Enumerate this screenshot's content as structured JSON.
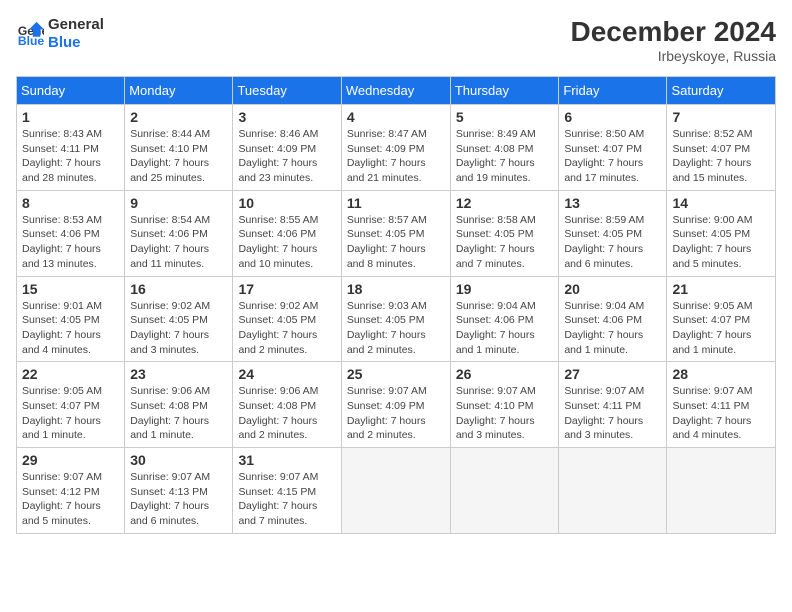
{
  "logo": {
    "line1": "General",
    "line2": "Blue"
  },
  "title": "December 2024",
  "location": "Irbeyskoye, Russia",
  "days_header": [
    "Sunday",
    "Monday",
    "Tuesday",
    "Wednesday",
    "Thursday",
    "Friday",
    "Saturday"
  ],
  "weeks": [
    [
      {
        "day": "1",
        "info": "Sunrise: 8:43 AM\nSunset: 4:11 PM\nDaylight: 7 hours\nand 28 minutes."
      },
      {
        "day": "2",
        "info": "Sunrise: 8:44 AM\nSunset: 4:10 PM\nDaylight: 7 hours\nand 25 minutes."
      },
      {
        "day": "3",
        "info": "Sunrise: 8:46 AM\nSunset: 4:09 PM\nDaylight: 7 hours\nand 23 minutes."
      },
      {
        "day": "4",
        "info": "Sunrise: 8:47 AM\nSunset: 4:09 PM\nDaylight: 7 hours\nand 21 minutes."
      },
      {
        "day": "5",
        "info": "Sunrise: 8:49 AM\nSunset: 4:08 PM\nDaylight: 7 hours\nand 19 minutes."
      },
      {
        "day": "6",
        "info": "Sunrise: 8:50 AM\nSunset: 4:07 PM\nDaylight: 7 hours\nand 17 minutes."
      },
      {
        "day": "7",
        "info": "Sunrise: 8:52 AM\nSunset: 4:07 PM\nDaylight: 7 hours\nand 15 minutes."
      }
    ],
    [
      {
        "day": "8",
        "info": "Sunrise: 8:53 AM\nSunset: 4:06 PM\nDaylight: 7 hours\nand 13 minutes."
      },
      {
        "day": "9",
        "info": "Sunrise: 8:54 AM\nSunset: 4:06 PM\nDaylight: 7 hours\nand 11 minutes."
      },
      {
        "day": "10",
        "info": "Sunrise: 8:55 AM\nSunset: 4:06 PM\nDaylight: 7 hours\nand 10 minutes."
      },
      {
        "day": "11",
        "info": "Sunrise: 8:57 AM\nSunset: 4:05 PM\nDaylight: 7 hours\nand 8 minutes."
      },
      {
        "day": "12",
        "info": "Sunrise: 8:58 AM\nSunset: 4:05 PM\nDaylight: 7 hours\nand 7 minutes."
      },
      {
        "day": "13",
        "info": "Sunrise: 8:59 AM\nSunset: 4:05 PM\nDaylight: 7 hours\nand 6 minutes."
      },
      {
        "day": "14",
        "info": "Sunrise: 9:00 AM\nSunset: 4:05 PM\nDaylight: 7 hours\nand 5 minutes."
      }
    ],
    [
      {
        "day": "15",
        "info": "Sunrise: 9:01 AM\nSunset: 4:05 PM\nDaylight: 7 hours\nand 4 minutes."
      },
      {
        "day": "16",
        "info": "Sunrise: 9:02 AM\nSunset: 4:05 PM\nDaylight: 7 hours\nand 3 minutes."
      },
      {
        "day": "17",
        "info": "Sunrise: 9:02 AM\nSunset: 4:05 PM\nDaylight: 7 hours\nand 2 minutes."
      },
      {
        "day": "18",
        "info": "Sunrise: 9:03 AM\nSunset: 4:05 PM\nDaylight: 7 hours\nand 2 minutes."
      },
      {
        "day": "19",
        "info": "Sunrise: 9:04 AM\nSunset: 4:06 PM\nDaylight: 7 hours\nand 1 minute."
      },
      {
        "day": "20",
        "info": "Sunrise: 9:04 AM\nSunset: 4:06 PM\nDaylight: 7 hours\nand 1 minute."
      },
      {
        "day": "21",
        "info": "Sunrise: 9:05 AM\nSunset: 4:07 PM\nDaylight: 7 hours\nand 1 minute."
      }
    ],
    [
      {
        "day": "22",
        "info": "Sunrise: 9:05 AM\nSunset: 4:07 PM\nDaylight: 7 hours\nand 1 minute."
      },
      {
        "day": "23",
        "info": "Sunrise: 9:06 AM\nSunset: 4:08 PM\nDaylight: 7 hours\nand 1 minute."
      },
      {
        "day": "24",
        "info": "Sunrise: 9:06 AM\nSunset: 4:08 PM\nDaylight: 7 hours\nand 2 minutes."
      },
      {
        "day": "25",
        "info": "Sunrise: 9:07 AM\nSunset: 4:09 PM\nDaylight: 7 hours\nand 2 minutes."
      },
      {
        "day": "26",
        "info": "Sunrise: 9:07 AM\nSunset: 4:10 PM\nDaylight: 7 hours\nand 3 minutes."
      },
      {
        "day": "27",
        "info": "Sunrise: 9:07 AM\nSunset: 4:11 PM\nDaylight: 7 hours\nand 3 minutes."
      },
      {
        "day": "28",
        "info": "Sunrise: 9:07 AM\nSunset: 4:11 PM\nDaylight: 7 hours\nand 4 minutes."
      }
    ],
    [
      {
        "day": "29",
        "info": "Sunrise: 9:07 AM\nSunset: 4:12 PM\nDaylight: 7 hours\nand 5 minutes."
      },
      {
        "day": "30",
        "info": "Sunrise: 9:07 AM\nSunset: 4:13 PM\nDaylight: 7 hours\nand 6 minutes."
      },
      {
        "day": "31",
        "info": "Sunrise: 9:07 AM\nSunset: 4:15 PM\nDaylight: 7 hours\nand 7 minutes."
      },
      null,
      null,
      null,
      null
    ]
  ]
}
